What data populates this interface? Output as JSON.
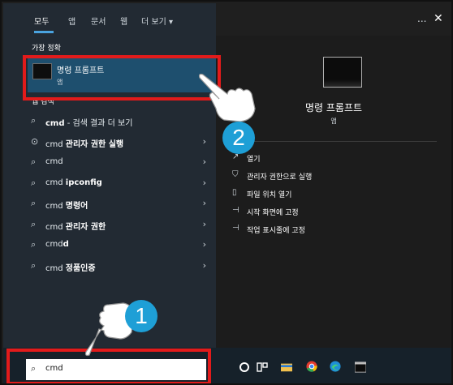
{
  "tabs": [
    {
      "label": "모두",
      "active": true
    },
    {
      "label": "앱",
      "active": false
    },
    {
      "label": "문서",
      "active": false
    },
    {
      "label": "웹",
      "active": false
    },
    {
      "label": "더 보기 ▾",
      "active": false
    }
  ],
  "more_icon": "...",
  "close_icon": "✕",
  "best_match": {
    "heading": "가장 정확",
    "name": "명령 프롬프트",
    "type": "앱"
  },
  "web_section": {
    "heading": "웹 검색"
  },
  "results": [
    {
      "icon": "search-icon",
      "prefix": "",
      "bold": "cmd",
      "rest": " - 검색 결과 더 보기",
      "chevron": false
    },
    {
      "icon": "web-icon",
      "prefix": "cmd ",
      "bold": "관리자 권한 실행",
      "rest": "",
      "chevron": true
    },
    {
      "icon": "search-icon",
      "prefix": "cmd",
      "bold": "",
      "rest": "",
      "chevron": true
    },
    {
      "icon": "search-icon",
      "prefix": "cmd ",
      "bold": "ipconfig",
      "rest": "",
      "chevron": true
    },
    {
      "icon": "search-icon",
      "prefix": "cmd ",
      "bold": "명령어",
      "rest": "",
      "chevron": true
    },
    {
      "icon": "search-icon",
      "prefix": "cmd ",
      "bold": "관리자 권한",
      "rest": "",
      "chevron": true
    },
    {
      "icon": "search-icon",
      "prefix": "cmd",
      "bold": "d",
      "rest": "",
      "chevron": true
    },
    {
      "icon": "search-icon",
      "prefix": "cmd ",
      "bold": "정품인증",
      "rest": "",
      "chevron": true
    }
  ],
  "preview": {
    "title": "명령 프롬프트",
    "type": "앱",
    "actions": [
      {
        "icon": "open-icon",
        "label": "열기"
      },
      {
        "icon": "shield-icon",
        "label": "관리자 권한으로 실행"
      },
      {
        "icon": "folder-icon",
        "label": "파일 위치 열기"
      },
      {
        "icon": "pin-icon",
        "label": "시작 화면에 고정"
      },
      {
        "icon": "pin-icon",
        "label": "작업 표시줄에 고정"
      }
    ]
  },
  "taskbar": {
    "search_value": "cmd",
    "icons": [
      "cortana-icon",
      "task-view-icon",
      "file-explorer-icon",
      "chrome-icon",
      "edge-icon",
      "terminal-icon"
    ]
  },
  "annotations": {
    "step1": "1",
    "step2": "2"
  },
  "colors": {
    "accent": "#1e9fd6",
    "highlight": "#e21b1b",
    "selected": "#1e4f6e"
  }
}
